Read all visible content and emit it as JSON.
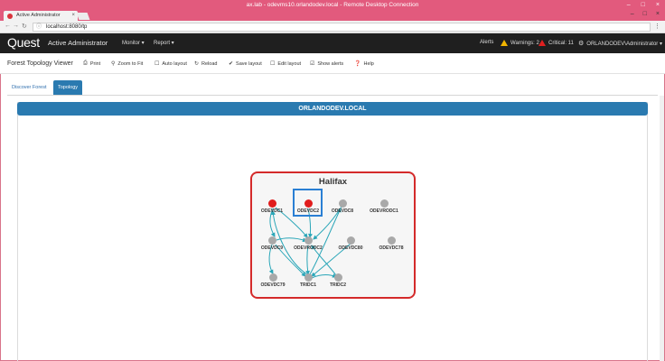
{
  "rdp": {
    "title": "ax.lab - odevms10.orlandodev.local - Remote Desktop Connection",
    "controls": [
      "–",
      "□",
      "×"
    ]
  },
  "browser": {
    "tab_title": "Active Administrator",
    "url": "localhost:8080/tp",
    "window_controls": [
      "–",
      "□",
      "×"
    ]
  },
  "app": {
    "logo": "Quest",
    "name": "Active Administrator",
    "nav": [
      "Monitor ▾",
      "Report ▾"
    ],
    "alerts_label": "Alerts",
    "warnings": "Warnings: 2",
    "critical": "Critical: 11",
    "user": "ORLANDODEV\\Administrator ▾"
  },
  "toolbar": {
    "page_title": "Forest Topology Viewer",
    "buttons": [
      {
        "label": "Print",
        "icon": "print-icon",
        "glyph": "⎙"
      },
      {
        "label": "Zoom to Fit",
        "icon": "zoom-icon",
        "glyph": "⚲"
      },
      {
        "label": "Auto layout",
        "icon": "checkbox-icon",
        "glyph": "☐"
      },
      {
        "label": "Reload",
        "icon": "reload-icon",
        "glyph": "↻"
      },
      {
        "label": "Save layout",
        "icon": "check-icon",
        "glyph": "✔"
      },
      {
        "label": "Edit layout",
        "icon": "checkbox-icon",
        "glyph": "☐"
      },
      {
        "label": "Show alerts",
        "icon": "checkbox-checked-icon",
        "glyph": "☑"
      },
      {
        "label": "Help",
        "icon": "help-icon",
        "glyph": "❓"
      }
    ]
  },
  "tabs": [
    {
      "label": "Discover Forest",
      "active": false
    },
    {
      "label": "Topology",
      "active": true
    }
  ],
  "panel": {
    "domain": "ORLANDODEV.LOCAL"
  },
  "site": {
    "name": "Halifax",
    "nodes": [
      {
        "label": "ODEVDC1",
        "status": "critical"
      },
      {
        "label": "ODEVDC2",
        "status": "critical"
      },
      {
        "label": "ODEVDC8",
        "status": "normal"
      },
      {
        "label": "ODEVRODC1",
        "status": "normal"
      },
      {
        "label": "ODEVDC9",
        "status": "normal"
      },
      {
        "label": "ODEVRODC2",
        "status": "normal"
      },
      {
        "label": "ODEVDC80",
        "status": "normal"
      },
      {
        "label": "ODEVDC78",
        "status": "normal"
      },
      {
        "label": "ODEVDC79",
        "status": "normal"
      },
      {
        "label": "TRIDC1",
        "status": "normal"
      },
      {
        "label": "TRIDC2",
        "status": "normal"
      }
    ]
  },
  "colors": {
    "accent": "#2a7ab0",
    "critical": "#e11d1d",
    "link": "#2aa6b8",
    "site_border": "#d42a2a"
  }
}
